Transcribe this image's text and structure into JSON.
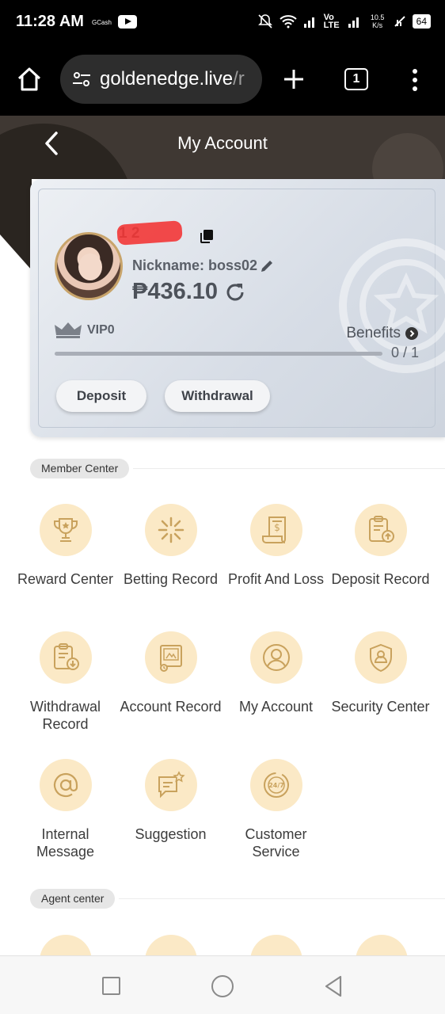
{
  "status_bar": {
    "time": "11:28 AM",
    "gcash": "GCash",
    "network_label": "Vo LTE",
    "speed": "10.5 K/s",
    "battery": "64"
  },
  "browser": {
    "url": "goldenedge.live",
    "url_rest": "/r",
    "tab_count": "1"
  },
  "header": {
    "title": "My Account"
  },
  "account": {
    "username_visible": "1          2",
    "nickname": "Nickname: boss02",
    "balance": "₱436.10",
    "vip_level": "VIP0",
    "benefits_label": "Benefits",
    "progress_text": "0 / 1",
    "progress_fraction": 0,
    "deposit_label": "Deposit",
    "withdrawal_label": "Withdrawal"
  },
  "member_center": {
    "title": "Member Center",
    "items": [
      {
        "label": "Reward Center",
        "icon": "trophy-icon"
      },
      {
        "label": "Betting Record",
        "icon": "star-burst-icon"
      },
      {
        "label": "Profit And Loss",
        "icon": "receipt-icon"
      },
      {
        "label": "Deposit Record",
        "icon": "clipboard-upload-icon"
      },
      {
        "label": "Withdrawal Record",
        "icon": "clipboard-download-icon"
      },
      {
        "label": "Account Record",
        "icon": "account-record-icon"
      },
      {
        "label": "My Account",
        "icon": "user-icon"
      },
      {
        "label": "Security Center",
        "icon": "shield-user-icon"
      },
      {
        "label": "Internal Message",
        "icon": "at-sign-icon"
      },
      {
        "label": "Suggestion",
        "icon": "chat-star-icon"
      },
      {
        "label": "Customer Service",
        "icon": "support-24-7-icon"
      }
    ]
  },
  "agent_center": {
    "title": "Agent center"
  },
  "colors": {
    "accent_bg": "#fbe9c6",
    "accent_icon": "#c9a25d",
    "header_bg": "#3f3833"
  }
}
